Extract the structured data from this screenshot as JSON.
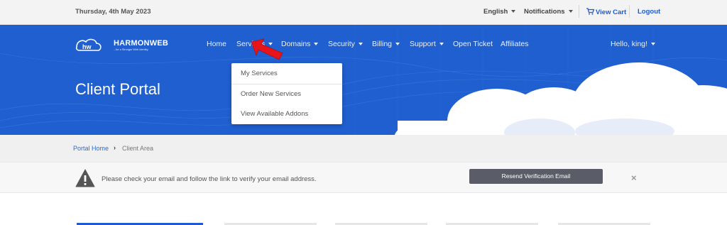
{
  "topbar": {
    "date": "Thursday, 4th May 2023",
    "language": "English",
    "notifications": "Notifications",
    "cart": "View Cart",
    "logout": "Logout"
  },
  "brand": {
    "name": "HARMONWEB",
    "tagline": "...for a Stronger Web Identity."
  },
  "nav": {
    "home": "Home",
    "services": "Services",
    "domains": "Domains",
    "security": "Security",
    "billing": "Billing",
    "support": "Support",
    "open_ticket": "Open Ticket",
    "affiliates": "Affiliates",
    "user": "Hello, king!"
  },
  "services_dropdown": {
    "items": [
      "My Services",
      "Order New Services",
      "View Available Addons"
    ]
  },
  "hero": {
    "title": "Client Portal"
  },
  "breadcrumb": {
    "home": "Portal Home",
    "current": "Client Area"
  },
  "alert": {
    "message": "Please check your email and follow the link to verify your email address.",
    "button": "Resend Verification Email",
    "close": "×"
  },
  "colors": {
    "brand_blue": "#1f5fcf",
    "link_blue": "#1e5bd1",
    "pointer_red": "#e8141c"
  }
}
